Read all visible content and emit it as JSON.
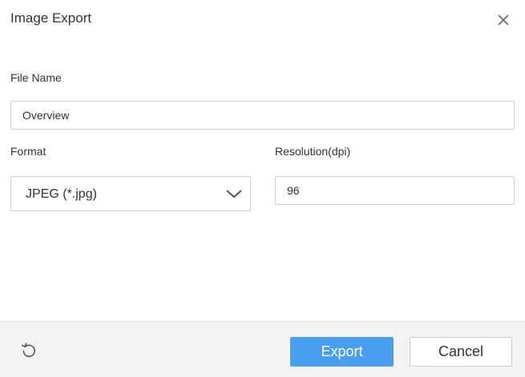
{
  "dialog": {
    "title": "Image Export",
    "close_icon": "close-icon"
  },
  "form": {
    "file_name_label": "File Name",
    "file_name_value": "Overview",
    "format_label": "Format",
    "format_value": "JPEG (*.jpg)",
    "resolution_label": "Resolution(dpi)",
    "resolution_value": "96"
  },
  "footer": {
    "reset_icon": "reset-icon",
    "export_label": "Export",
    "cancel_label": "Cancel"
  },
  "colors": {
    "accent": "#4a9ff0",
    "footer_bg": "#f3f3f3",
    "border": "#cfcfcf"
  }
}
